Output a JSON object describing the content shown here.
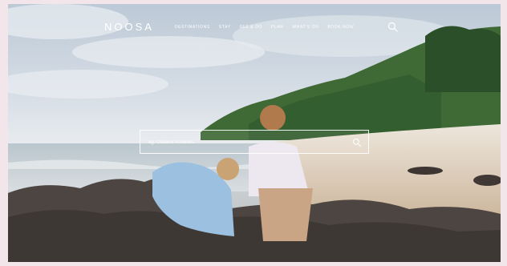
{
  "brand": {
    "logo_text": "NOOSA"
  },
  "nav": {
    "items": [
      {
        "label": "DESTINATIONS"
      },
      {
        "label": "STAY"
      },
      {
        "label": "SEE & DO"
      },
      {
        "label": "PLAN"
      },
      {
        "label": "WHAT'S ON"
      },
      {
        "label": "BOOK NOW"
      }
    ],
    "search_icon": "search-icon"
  },
  "search": {
    "placeholder": "eg. Outdoor Activities",
    "value": "",
    "submit_icon": "search-icon"
  },
  "colors": {
    "text": "#ffffff",
    "sky": "#d7dee6",
    "sea": "#c4cdd4",
    "headland": "#3f6a36",
    "rocks": "#4c4541"
  }
}
